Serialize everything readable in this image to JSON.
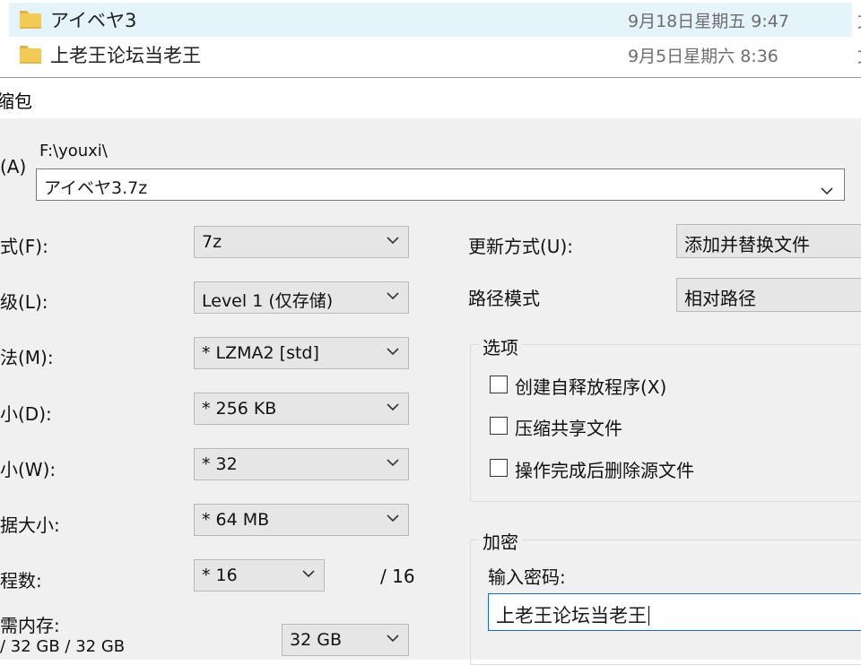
{
  "explorer": {
    "files": [
      {
        "name": "アイベヤ3",
        "date": "9月18日星期五 9:47",
        "extra": "文"
      },
      {
        "name": "上老王论坛当老王",
        "date": "9月5日星期六 8:36",
        "extra": "文"
      }
    ]
  },
  "dialog": {
    "title": "缩包",
    "archive": {
      "label": "(A)",
      "folder": "F:\\youxi\\",
      "filename": "アイベヤ3.7z"
    },
    "left_labels": {
      "format": "式(F):",
      "level": "级(L):",
      "method": "法(M):",
      "dict": "小(D):",
      "word": "小(W):",
      "solid": "据大小:",
      "threads": "程数:",
      "memory": "需内存:",
      "memory_value": "/ 32 GB / 32 GB"
    },
    "combos": {
      "format": "7z",
      "level": "Level 1 (仅存储)",
      "method": "*  LZMA2 [std]",
      "dict": "*  256 KB",
      "word": "*  32",
      "solid": "*  64 MB",
      "threads": "*  16",
      "threads_max": "/ 16",
      "memory": "32 GB"
    },
    "right": {
      "update_label": "更新方式(U):",
      "update_value": "添加并替换文件",
      "path_label": "路径模式",
      "path_value": "相对路径"
    },
    "options": {
      "caption": "选项",
      "sfx": "创建自释放程序(X)",
      "shared": "压缩共享文件",
      "delete": "操作完成后删除源文件"
    },
    "encryption": {
      "caption": "加密",
      "password_label": "输入密码:",
      "password_value": "上老王论坛当老王"
    }
  }
}
